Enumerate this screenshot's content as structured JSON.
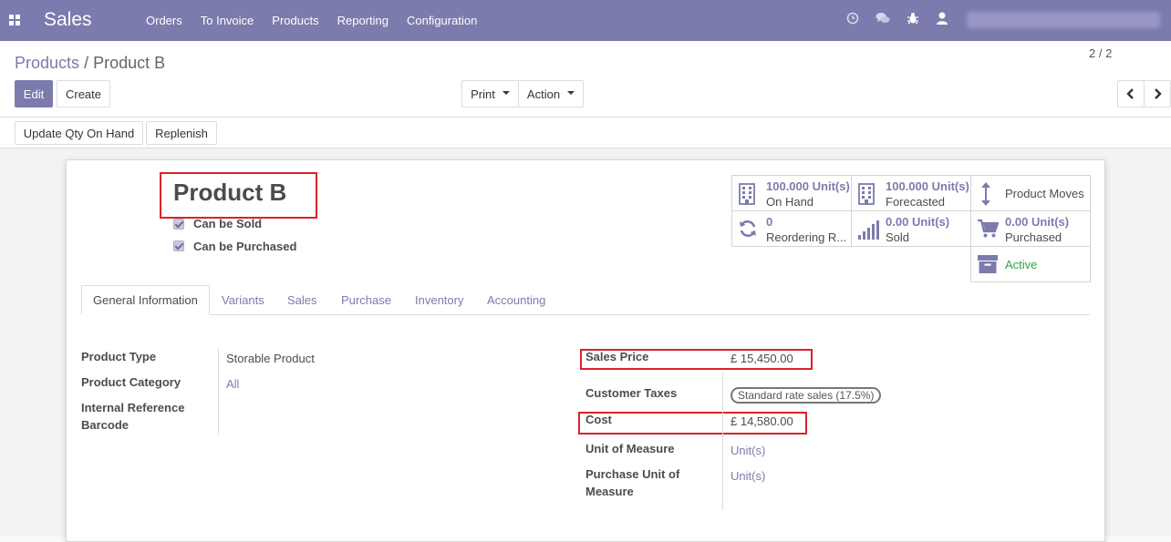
{
  "nav": {
    "app_name": "Sales",
    "menu": [
      "Orders",
      "To Invoice",
      "Products",
      "Reporting",
      "Configuration"
    ]
  },
  "breadcrumb": {
    "parent": "Products",
    "separator": "/",
    "current": "Product B"
  },
  "buttons": {
    "edit": "Edit",
    "create": "Create",
    "print": "Print",
    "action": "Action",
    "update_qty": "Update Qty On Hand",
    "replenish": "Replenish"
  },
  "pager": {
    "text": "2 / 2"
  },
  "product": {
    "name": "Product B",
    "can_be_sold": "Can be Sold",
    "can_be_purchased": "Can be Purchased"
  },
  "stats": {
    "on_hand": {
      "value": "100.000",
      "unit": "Unit(s)",
      "label": "On Hand"
    },
    "forecasted": {
      "value": "100.000",
      "unit": "Unit(s)",
      "label": "Forecasted"
    },
    "product_moves": {
      "label": "Product Moves"
    },
    "reordering": {
      "value": "0",
      "label": "Reordering R..."
    },
    "sold": {
      "value": "0.00",
      "unit": "Unit(s)",
      "label": "Sold"
    },
    "purchased": {
      "value": "0.00",
      "unit": "Unit(s)",
      "label": "Purchased"
    },
    "active": {
      "label": "Active"
    }
  },
  "tabs": [
    "General Information",
    "Variants",
    "Sales",
    "Purchase",
    "Inventory",
    "Accounting"
  ],
  "general": {
    "product_type_label": "Product Type",
    "product_type_value": "Storable Product",
    "product_category_label": "Product Category",
    "product_category_value": "All",
    "internal_reference_label": "Internal Reference",
    "barcode_label": "Barcode",
    "sales_price_label": "Sales Price",
    "sales_price_value": "£ 15,450.00",
    "customer_taxes_label": "Customer Taxes",
    "customer_taxes_value": "Standard rate sales (17.5%)",
    "cost_label": "Cost",
    "cost_value": "£ 14,580.00",
    "uom_label": "Unit of Measure",
    "uom_value": "Unit(s)",
    "purchase_uom_label_1": "Purchase Unit of",
    "purchase_uom_label_2": "Measure",
    "purchase_uom_value": "Unit(s)"
  },
  "colors": {
    "brand": "#7c7bad",
    "highlight": "#d9222a",
    "active_green": "#28a745"
  }
}
